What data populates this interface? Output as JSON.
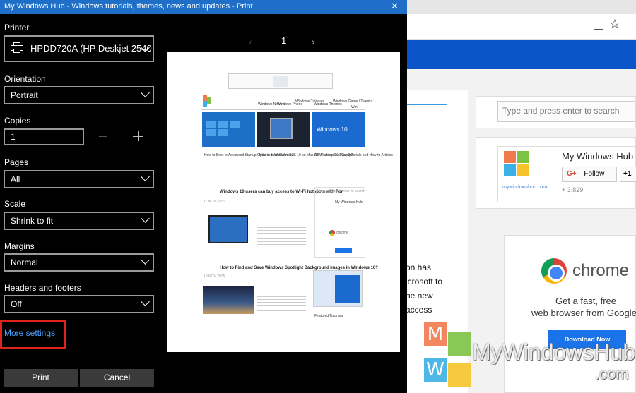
{
  "dialog": {
    "title": "My Windows Hub - Windows tutorials, themes, news and updates - Print",
    "close_glyph": "✕",
    "printer": {
      "label": "Printer",
      "value": "HPDD720A (HP Deskjet 2540",
      "icon": "printer-icon"
    },
    "orientation": {
      "label": "Orientation",
      "value": "Portrait"
    },
    "copies": {
      "label": "Copies",
      "value": "1"
    },
    "pages": {
      "label": "Pages",
      "value": "All"
    },
    "scale": {
      "label": "Scale",
      "value": "Shrink to fit"
    },
    "margins": {
      "label": "Margins",
      "value": "Normal"
    },
    "headers": {
      "label": "Headers and footers",
      "value": "Off"
    },
    "more_settings": "More settings",
    "print_button": "Print",
    "cancel_button": "Cancel",
    "highlight_color": "#e0231b",
    "link_color": "#4aa3ff",
    "titlebar_color": "#1f6fc9"
  },
  "preview": {
    "page_number": "1",
    "prev_glyph": "‹",
    "next_glyph": "›",
    "nav_items": [
      "Windows News",
      "Windows Phone",
      "Windows Tutorials",
      "Windows Themes",
      "Windows Game / Tweaks",
      "Win"
    ],
    "tiles": [
      {
        "caption": "How to Boot to Advanced Startup Options in Windows 10?",
        "img": "Windows 10"
      },
      {
        "caption": "How to Install Windows 10 on Mac OS X using Boot Camp?",
        "img": ""
      },
      {
        "caption": "All Windows 10 Tips, Tutorials and How-to Articles",
        "img": "Windows 10"
      }
    ],
    "post1_title": "Windows 10 users can buy access to Wi-Fi hotspots with Fon",
    "post1_date": "11 NOV 2015",
    "post2_title": "How to Find and Save Windows Spotlight Background Images in Windows 10?",
    "post2_date": "10 NOV 2015",
    "sidebar_search": "Type and press enter to search",
    "sidebar_widget": "My Windows Hub",
    "sidebar_chrome": "chrome",
    "featured": "Featured Tutorials"
  },
  "browser": {
    "search_placeholder": "Type and press enter to search",
    "widget_title": "My Windows Hub",
    "widget_url": "mywindowshub.com",
    "follow_label": "Follow",
    "plus_one": "+1",
    "follower_count": "+ 3,829",
    "article_lines": [
      "on has",
      "icrosoft to",
      "he new",
      "access"
    ],
    "chrome_word": "chrome",
    "chrome_line1": "Get a fast, free",
    "chrome_line2": "web browser from Google",
    "download_button": "Download Now",
    "nav_color": "#0a55c8"
  },
  "watermark": {
    "letters": [
      "M",
      "W"
    ],
    "brand": "MyWindowsHub",
    "dotcom": ".com"
  }
}
